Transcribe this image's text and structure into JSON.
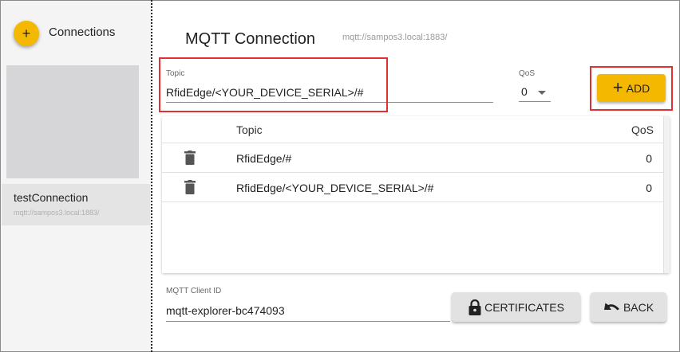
{
  "sidebar": {
    "add_icon": "plus-icon",
    "header": "Connections",
    "connections": [
      {
        "name": "testConnection",
        "url": "mqtt://sampos3.local:1883/"
      }
    ]
  },
  "main": {
    "title": "MQTT Connection",
    "url": "mqtt://sampos3.local:1883/",
    "topic_field": {
      "label": "Topic",
      "value": "RfidEdge/<YOUR_DEVICE_SERIAL>/#"
    },
    "qos_field": {
      "label": "QoS",
      "value": "0"
    },
    "add_button": {
      "icon": "plus-icon",
      "label": "ADD"
    },
    "table": {
      "headers": {
        "topic": "Topic",
        "qos": "QoS"
      },
      "rows": [
        {
          "topic": "RfidEdge/#",
          "qos": "0",
          "icon": "trash-icon"
        },
        {
          "topic": "RfidEdge/<YOUR_DEVICE_SERIAL>/#",
          "qos": "0",
          "icon": "trash-icon"
        }
      ]
    },
    "client_id_field": {
      "label": "MQTT Client ID",
      "value": "mqtt-explorer-bc474093"
    },
    "certificates_button": {
      "icon": "lock-icon",
      "label": "CERTIFICATES"
    },
    "back_button": {
      "icon": "undo-icon",
      "label": "BACK"
    }
  },
  "colors": {
    "accent": "#f5b800",
    "highlight": "#e03030",
    "sidebar_bg": "#f4f4f4",
    "button_grey": "#e2e2e2"
  }
}
